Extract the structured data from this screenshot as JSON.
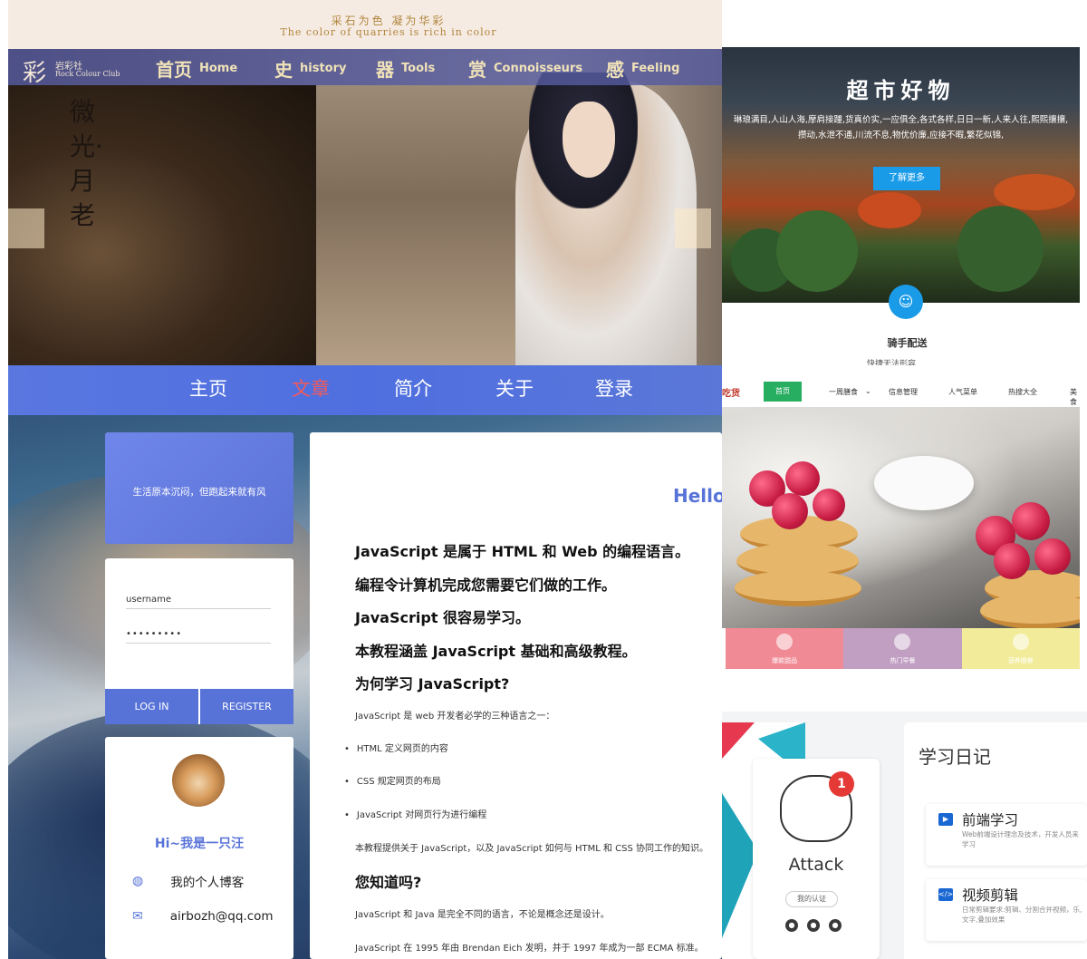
{
  "rock_club": {
    "slogan_cn": "采石为色  凝为华彩",
    "slogan_en": "The color of quarries is rich in color",
    "brand_mark": "彩",
    "brand_cn": "岩彩社",
    "brand_en": "Rock Colour Club",
    "nav": [
      {
        "cn": "首页",
        "en": "Home"
      },
      {
        "cn": "史",
        "en": "history"
      },
      {
        "cn": "器",
        "en": "Tools"
      },
      {
        "cn": "赏",
        "en": "Connoisseurs"
      },
      {
        "cn": "感",
        "en": "Feeling"
      }
    ],
    "artwork_title": "微光·月老",
    "arrow_left": "‹",
    "arrow_right": "›"
  },
  "market": {
    "title": "超市好物",
    "desc_line1": "琳琅满目,人山人海,摩肩接踵,货真价实,一应俱全,各式各样,日日一新,人来人往,熙熙攘攘,",
    "desc_line2": "攒动,水泄不通,川流不息,物优价廉,应接不暇,繁花似锦,",
    "button": "了解更多",
    "feature_title": "骑手配送",
    "feature_sub": "快捷无法形容"
  },
  "food": {
    "logo": "吃货",
    "tabs": [
      "首页",
      "一周膳食",
      "信息管理",
      "人气菜单",
      "热搜大全",
      "美食"
    ],
    "tiles": [
      {
        "label": "爆款甜品",
        "color": "#f08a95"
      },
      {
        "label": "热门早餐",
        "color": "#c19fc2"
      },
      {
        "label": "营养晚餐",
        "color": "#f2ec9a"
      }
    ]
  },
  "blog": {
    "nav": [
      "主页",
      "文章",
      "简介",
      "关于",
      "登录"
    ],
    "active_nav": "文章",
    "quote": "生活原本沉闷，但跑起来就有风",
    "username_value": "username",
    "password_value": "•••••••••",
    "login_btn": "LOG IN",
    "register_btn": "REGISTER",
    "greeting": "Hi~我是一只汪",
    "blog_label": "我的个人博客",
    "email": "airbozh@qq.com",
    "article": {
      "hello": "Hello",
      "lines": [
        "JavaScript 是属于 HTML 和 Web 的编程语言。",
        "编程令计算机完成您需要它们做的工作。",
        "JavaScript 很容易学习。",
        "本教程涵盖 JavaScript 基础和高级教程。",
        "为何学习 JavaScript?"
      ],
      "intro": "JavaScript 是 web 开发者必学的三种语言之一：",
      "bullets": [
        "HTML 定义网页的内容",
        "CSS 规定网页的布局",
        "JavaScript 对网页行为进行编程"
      ],
      "para": "本教程提供关于 JavaScript，以及 JavaScript 如何与 HTML 和 CSS 协同工作的知识。",
      "did_you_know": "您知道吗?",
      "fact1": "JavaScript 和 Java 是完全不同的语言，不论是概念还是设计。",
      "fact2": "JavaScript 在 1995 年由 Brendan Eich 发明，并于 1997 年成为一部 ECMA 标准。"
    }
  },
  "diary": {
    "badge": "1",
    "username": "Attack",
    "cert": "我的认证",
    "title": "学习日记",
    "entries": [
      {
        "title": "前端学习",
        "desc": "Web前端设计理念及技术，开发人员来学习"
      },
      {
        "title": "视频剪辑",
        "desc": "日常剪辑要求:剪辑、分割合并视频，乐,文字,叠加效果"
      }
    ]
  }
}
